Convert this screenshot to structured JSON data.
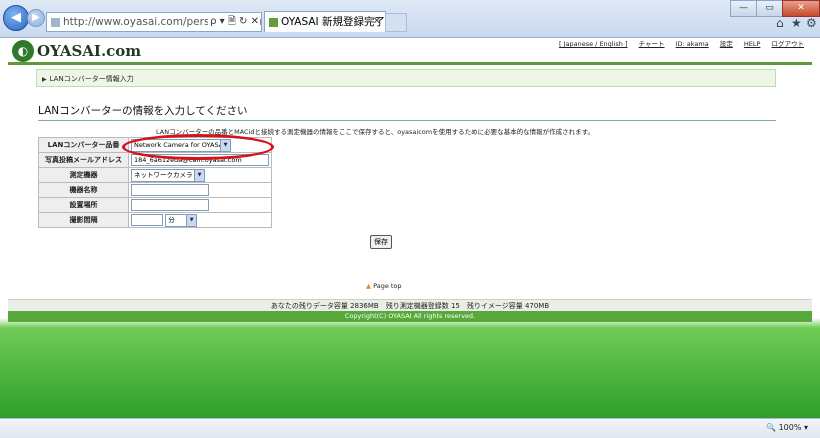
{
  "browser": {
    "address": "http://www.oyasai.com/personal/first/mov",
    "address_controls": "ρ ▾ 🗎 ↻ ✕",
    "tab_title": "OYASAI 新規登録完了",
    "tab_close": "✕",
    "window_min": "—",
    "window_max": "▭",
    "window_close": "✕",
    "icons": [
      "home-icon",
      "favorites-star-icon",
      "settings-gear-icon"
    ]
  },
  "site": {
    "logo": "OYASAI.com",
    "toplinks": [
      "[ Japanese / English ]",
      "チャート",
      "ID: akama",
      "設定",
      "HELP",
      "ログアウト"
    ]
  },
  "breadcrumb": "LANコンバーター情報入力",
  "heading": "LANコンバーターの情報を入力してください",
  "description": "LANコンバーターの品番とMACidと接続する測定機器の情報をここで保存すると、oyasaicomを使用するために必要な基本的な情報が作成されます。",
  "form": {
    "rows": [
      {
        "label": "LANコンバーター品番",
        "value": "Network Camera for OYASAI"
      },
      {
        "label": "写真投稿メールアドレス",
        "value": "184_6a612eda@cam.oyasai.com"
      },
      {
        "label": "測定機器",
        "value": "ネットワークカメラ"
      },
      {
        "label": "機器名称",
        "value": ""
      },
      {
        "label": "設置場所",
        "value": ""
      },
      {
        "label": "撮影間隔",
        "value": "",
        "unit": "分"
      }
    ],
    "save_label": "保存"
  },
  "page_top": "Page top",
  "footer": {
    "usage": "あなたの残りデータ容量 2836MB　残り測定機器登録数 15　残りイメージ容量 470MB",
    "copyright": "Copyright(C) OYASAI All rights reserved."
  },
  "status": {
    "zoom": "100%"
  },
  "colors": {
    "brand_green": "#58a83a",
    "highlight_circle": "#d4141a"
  }
}
